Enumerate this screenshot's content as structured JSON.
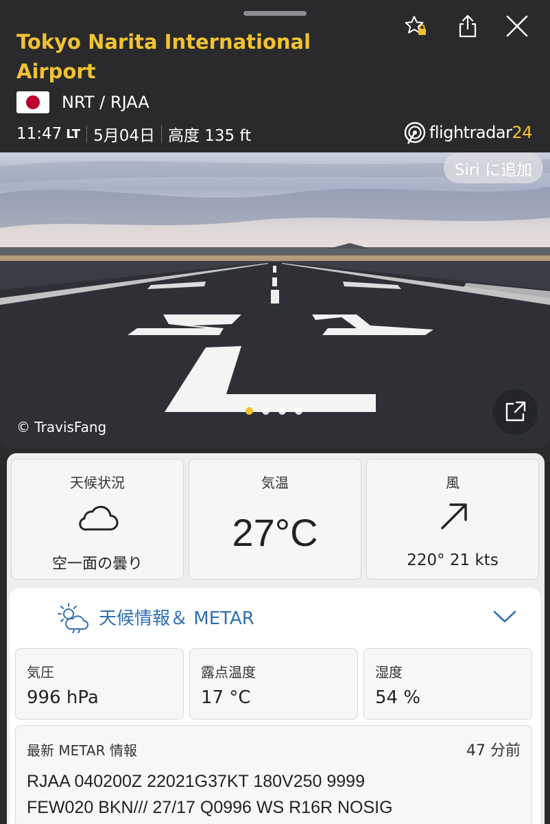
{
  "header": {
    "title": "Tokyo Narita International Airport",
    "codes": "NRT / RJAA",
    "time": "11:47",
    "time_suffix": "LT",
    "date": "5月04日",
    "altitude": "高度 135 ft",
    "brand_main": "flightradar",
    "brand_num": "24",
    "accent_color": "#f2c232"
  },
  "icons": {
    "favorite": "star-lock-icon",
    "share": "share-icon",
    "close": "close-icon",
    "expand": "expand-icon",
    "weather": "weather-cloud-sun-icon",
    "chevron": "chevron-down-icon"
  },
  "photo": {
    "siri_label": "Siri に追加",
    "credit": "© TravisFang",
    "page_count": 4,
    "active_page": 1
  },
  "weather": {
    "condition_label": "天候状況",
    "condition_value": "空一面の曇り",
    "temp_label": "気温",
    "temp_value": "27°C",
    "wind_label": "風",
    "wind_value": "220° 21 kts"
  },
  "metar_section": {
    "title": "天候情報＆ METAR",
    "title_color": "#2f6fb3",
    "pressure_label": "気圧",
    "pressure_value": "996 hPa",
    "dewpoint_label": "露点温度",
    "dewpoint_value": "17 °C",
    "humidity_label": "湿度",
    "humidity_value": "54 %",
    "latest_label": "最新 METAR 情報",
    "latest_age": "47 分前",
    "raw_line1": "RJAA 040200Z 22021G37KT 180V250 9999",
    "raw_line2": "FEW020 BKN/// 27/17 Q0996 WS R16R NOSIG"
  }
}
